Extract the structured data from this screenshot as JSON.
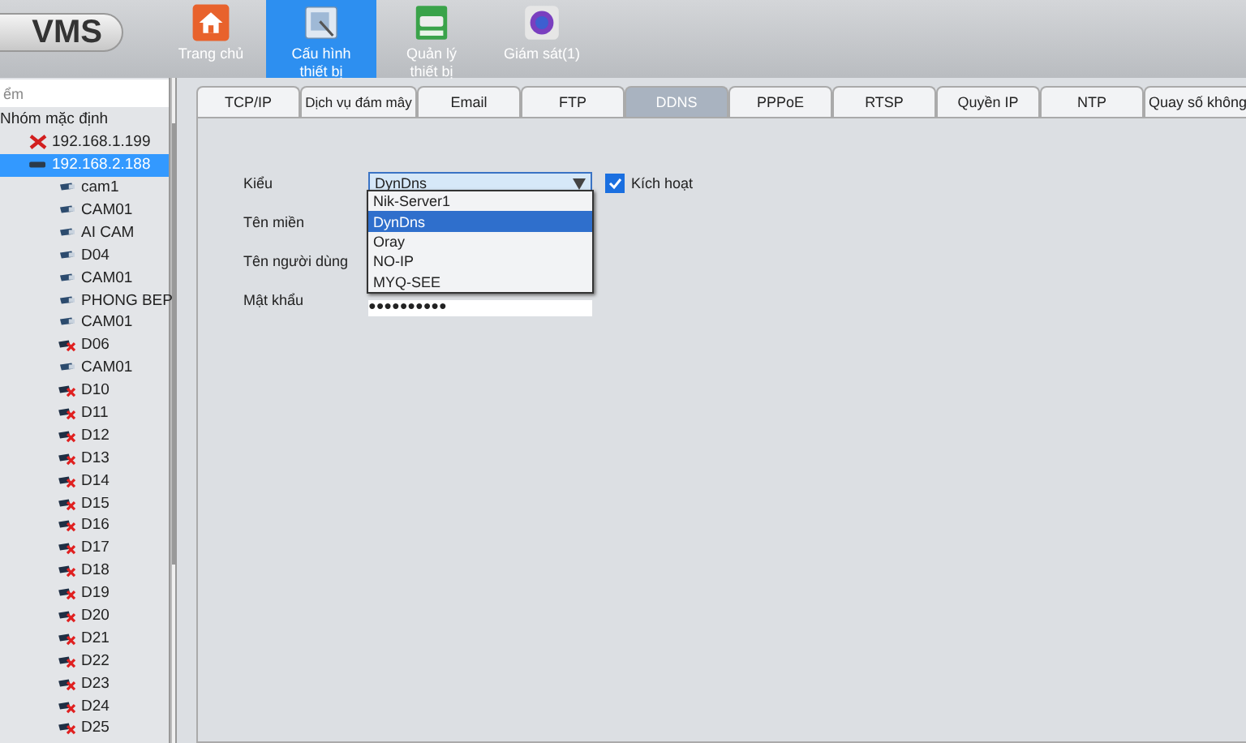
{
  "logo": "VMS",
  "nav": [
    {
      "label": "Trang chủ",
      "selected": false
    },
    {
      "label": "Cấu hình\nthiết bị",
      "selected": true
    },
    {
      "label": "Quản lý\nthiết bị",
      "selected": false
    },
    {
      "label": "Giám sát(1)",
      "selected": false
    }
  ],
  "sidebar": {
    "search": {
      "placeholder": "ểm"
    },
    "tree": [
      {
        "label": "Nhóm mặc định",
        "selected": false,
        "children": [
          {
            "label": "192.168.1.199",
            "kind": "device-offline",
            "selected": false
          },
          {
            "label": "192.168.2.188",
            "kind": "device",
            "selected": true,
            "children": [
              {
                "label": "cam1",
                "kind": "camera",
                "selected": false
              },
              {
                "label": "CAM01",
                "kind": "camera",
                "selected": false
              },
              {
                "label": "AI CAM",
                "kind": "camera",
                "selected": false
              },
              {
                "label": "D04",
                "kind": "camera",
                "selected": false
              },
              {
                "label": "CAM01",
                "kind": "camera",
                "selected": false
              },
              {
                "label": "PHONG BEP",
                "kind": "camera",
                "selected": false
              },
              {
                "label": "CAM01",
                "kind": "camera",
                "selected": false
              },
              {
                "label": "D06",
                "kind": "camera-offline",
                "selected": false
              },
              {
                "label": "CAM01",
                "kind": "camera",
                "selected": false
              },
              {
                "label": "D10",
                "kind": "camera-offline",
                "selected": false
              },
              {
                "label": "D11",
                "kind": "camera-offline",
                "selected": false
              },
              {
                "label": "D12",
                "kind": "camera-offline",
                "selected": false
              },
              {
                "label": "D13",
                "kind": "camera-offline",
                "selected": false
              },
              {
                "label": "D14",
                "kind": "camera-offline",
                "selected": false
              },
              {
                "label": "D15",
                "kind": "camera-offline",
                "selected": false
              },
              {
                "label": "D16",
                "kind": "camera-offline",
                "selected": false
              },
              {
                "label": "D17",
                "kind": "camera-offline",
                "selected": false
              },
              {
                "label": "D18",
                "kind": "camera-offline",
                "selected": false
              },
              {
                "label": "D19",
                "kind": "camera-offline",
                "selected": false
              },
              {
                "label": "D20",
                "kind": "camera-offline",
                "selected": false
              },
              {
                "label": "D21",
                "kind": "camera-offline",
                "selected": false
              },
              {
                "label": "D22",
                "kind": "camera-offline",
                "selected": false
              },
              {
                "label": "D23",
                "kind": "camera-offline",
                "selected": false
              },
              {
                "label": "D24",
                "kind": "camera-offline",
                "selected": false
              },
              {
                "label": "D25",
                "kind": "camera-offline",
                "selected": false
              }
            ]
          }
        ]
      }
    ]
  },
  "tabs": [
    {
      "label": "TCP/IP",
      "selected": false
    },
    {
      "label": "Dịch vụ đám mây",
      "selected": false
    },
    {
      "label": "Email",
      "selected": false
    },
    {
      "label": "FTP",
      "selected": false
    },
    {
      "label": "DDNS",
      "selected": true
    },
    {
      "label": "PPPoE",
      "selected": false
    },
    {
      "label": "RTSP",
      "selected": false
    },
    {
      "label": "Quyền IP",
      "selected": false
    },
    {
      "label": "NTP",
      "selected": false
    },
    {
      "label": "Quay số không",
      "selected": false
    }
  ],
  "form": {
    "type_label": "Kiểu",
    "type_value": "DynDns",
    "enable": {
      "label": "Kích hoạt",
      "checked": true
    },
    "domain_label": "Tên miền",
    "user_label": "Tên người dùng",
    "password_label": "Mật khẩu",
    "password_value": "●●●●●●●●●●",
    "dropdown": [
      {
        "label": "Nik-Server1",
        "selected": false
      },
      {
        "label": "DynDns",
        "selected": true
      },
      {
        "label": "Oray",
        "selected": false
      },
      {
        "label": "NO-IP",
        "selected": false
      },
      {
        "label": "MYQ-SEE",
        "selected": false
      }
    ]
  }
}
